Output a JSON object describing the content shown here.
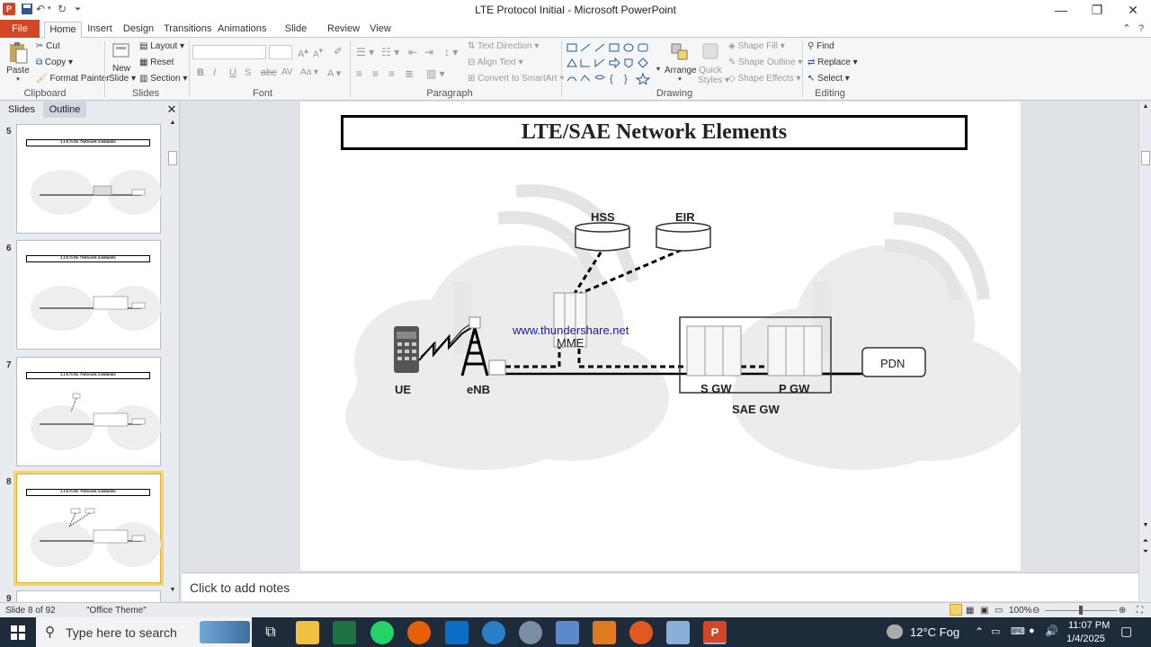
{
  "window": {
    "title": "LTE Protocol Initial  -  Microsoft PowerPoint"
  },
  "tabs": [
    "File",
    "Home",
    "Insert",
    "Design",
    "Transitions",
    "Animations",
    "Slide Show",
    "Review",
    "View"
  ],
  "ribbon": {
    "clipboard": {
      "paste": "Paste",
      "cut": "Cut",
      "copy": "Copy",
      "format_painter": "Format Painter",
      "label": "Clipboard"
    },
    "slides": {
      "new_slide_1": "New",
      "new_slide_2": "Slide",
      "layout": "Layout",
      "reset": "Reset",
      "section": "Section",
      "label": "Slides"
    },
    "font": {
      "label": "Font"
    },
    "paragraph": {
      "text_direction": "Text Direction",
      "align_text": "Align Text",
      "convert_smartart": "Convert to SmartArt",
      "label": "Paragraph"
    },
    "drawing": {
      "arrange": "Arrange",
      "quick_styles_1": "Quick",
      "quick_styles_2": "Styles",
      "shape_fill": "Shape Fill",
      "shape_outline": "Shape Outline",
      "shape_effects": "Shape Effects",
      "label": "Drawing"
    },
    "editing": {
      "find": "Find",
      "replace": "Replace",
      "select": "Select",
      "label": "Editing"
    }
  },
  "left_pane": {
    "tab_slides": "Slides",
    "tab_outline": "Outline",
    "thumbnails": [
      {
        "num": "5",
        "title": "LTE/SAE Network Elements"
      },
      {
        "num": "6",
        "title": "LTE/SAE Network Elements"
      },
      {
        "num": "7",
        "title": "LTE/SAE Network Elements"
      },
      {
        "num": "8",
        "title": "LTE/SAE Network Elements"
      },
      {
        "num": "9",
        "title": ""
      }
    ]
  },
  "slide": {
    "title": "LTE/SAE Network Elements",
    "labels": {
      "ue": "UE",
      "enb": "eNB",
      "mme": "MME",
      "hss": "HSS",
      "eir": "EIR",
      "sgw": "S GW",
      "pgw": "P GW",
      "saegw": "SAE GW",
      "pdn": "PDN"
    },
    "watermark": "www.thundershare.net"
  },
  "notes": {
    "placeholder": "Click to add notes"
  },
  "status": {
    "slide_info": "Slide 8 of 92",
    "theme": "\"Office Theme\"",
    "zoom": "100%"
  },
  "taskbar": {
    "search_placeholder": "Type here to search",
    "weather": "12°C  Fog",
    "time": "11:07 PM",
    "date": "1/4/2025"
  }
}
